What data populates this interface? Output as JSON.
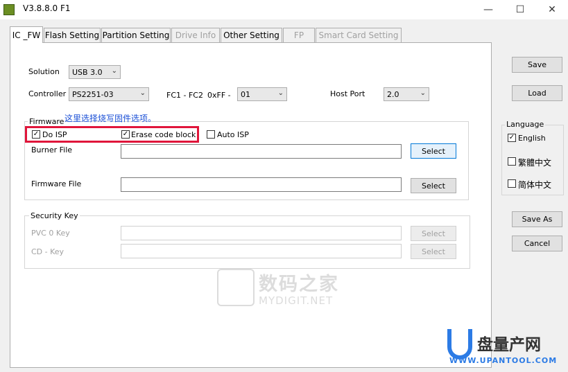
{
  "window": {
    "title": "V3.8.8.0 F1",
    "minimize_icon": "minimize-icon",
    "maximize_icon": "maximize-icon",
    "close_icon": "close-icon"
  },
  "tabs": [
    {
      "label": "IC _FW",
      "state": "active"
    },
    {
      "label": "Flash Setting",
      "state": "normal"
    },
    {
      "label": "Partition Setting",
      "state": "normal"
    },
    {
      "label": "Drive Info",
      "state": "disabled"
    },
    {
      "label": "Other Setting",
      "state": "normal"
    },
    {
      "label": "FP",
      "state": "disabled"
    },
    {
      "label": "Smart Card Setting",
      "state": "disabled"
    }
  ],
  "solution": {
    "label": "Solution",
    "value": "USB 3.0"
  },
  "controller": {
    "label": "Controller",
    "value": "PS2251-03"
  },
  "fc": {
    "label": "FC1 - FC2",
    "prefix": "0xFF -",
    "value": "01"
  },
  "host_port": {
    "label": "Host Port",
    "value": "2.0"
  },
  "firmware": {
    "group_label": "Firmware",
    "do_isp": {
      "label": "Do ISP",
      "checked": true
    },
    "erase_code_block": {
      "label": "Erase code block",
      "checked": true
    },
    "auto_isp": {
      "label": "Auto ISP",
      "checked": false
    },
    "burner_file_label": "Burner File",
    "burner_file_value": "",
    "firmware_file_label": "Firmware File",
    "firmware_file_value": "",
    "select_label": "Select"
  },
  "security_key": {
    "group_label": "Security Key",
    "pvc_label": "PVC 0 Key",
    "cd_label": "CD - Key",
    "select_label": "Select"
  },
  "annotation": {
    "text": "这里选择烧写固件选项。",
    "color": "#e0153a"
  },
  "right_panel": {
    "save": "Save",
    "load": "Load",
    "language_label": "Language",
    "languages": [
      {
        "label": "English",
        "checked": true
      },
      {
        "label": "繁體中文",
        "checked": false
      },
      {
        "label": "简体中文",
        "checked": false
      }
    ],
    "save_as": "Save As",
    "cancel": "Cancel"
  },
  "watermarks": {
    "mydigit_cn": "数码之家",
    "mydigit_en": "MYDIGIT.NET",
    "upantool_cn": "盘量产网",
    "upantool_en": "WWW.UPANTOOL.COM"
  }
}
